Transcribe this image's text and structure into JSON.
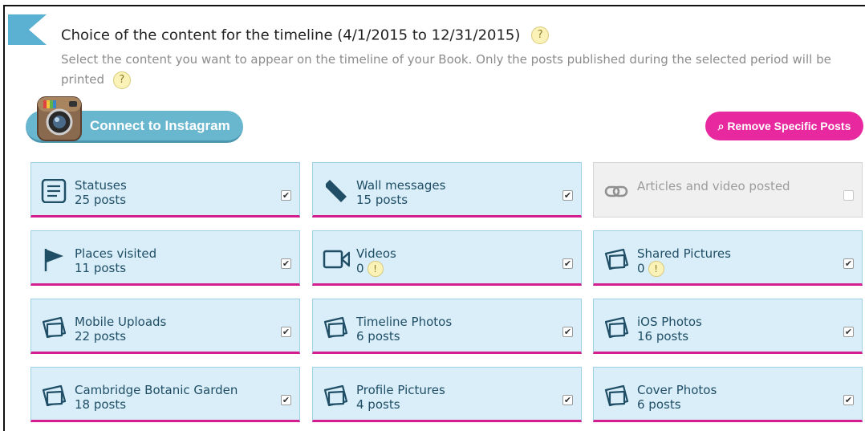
{
  "header": {
    "title": "Choice of the content for the timeline (4/1/2015 to 12/31/2015)",
    "help_glyph": "?",
    "subtitle": "Select the content you want to appear on the timeline of your Book. Only the posts published during the selected period will be printed"
  },
  "buttons": {
    "instagram": "Connect to Instagram",
    "remove_posts": "⌕ Remove Specific Posts"
  },
  "cards": [
    {
      "label": "Statuses",
      "count": "25 posts",
      "icon": "status-icon",
      "checked": true
    },
    {
      "label": "Wall messages",
      "count": "15 posts",
      "icon": "pencil-icon",
      "checked": true
    },
    {
      "label": "Articles and video posted",
      "count": "",
      "icon": "link-icon",
      "checked": false
    },
    {
      "label": "Places visited",
      "count": "11 posts",
      "icon": "flag-icon",
      "checked": true
    },
    {
      "label": "Videos",
      "count": "0",
      "icon": "video-camera-icon",
      "checked": true
    },
    {
      "label": "Shared Pictures",
      "count": "0",
      "icon": "photo-album-icon",
      "checked": true
    },
    {
      "label": "Mobile Uploads",
      "count": "22 posts",
      "icon": "photo-album-icon",
      "checked": true
    },
    {
      "label": "Timeline Photos",
      "count": "6 posts",
      "icon": "photo-album-icon",
      "checked": true
    },
    {
      "label": "iOS Photos",
      "count": "16 posts",
      "icon": "photo-album-icon",
      "checked": true
    },
    {
      "label": "Cambridge Botanic Garden",
      "count": "18 posts",
      "icon": "photo-album-icon",
      "checked": true
    },
    {
      "label": "Profile Pictures",
      "count": "4 posts",
      "icon": "photo-album-icon",
      "checked": true
    },
    {
      "label": "Cover Photos",
      "count": "6 posts",
      "icon": "photo-album-icon",
      "checked": true
    }
  ],
  "warning_glyph": "!",
  "check_glyph": "✔",
  "colors": {
    "card_bg": "#d9eef8",
    "card_accent": "#d61d8f",
    "instagram_button": "#69b6cf",
    "remove_button": "#e8289f",
    "disabled_card": "#f0f0f0"
  }
}
